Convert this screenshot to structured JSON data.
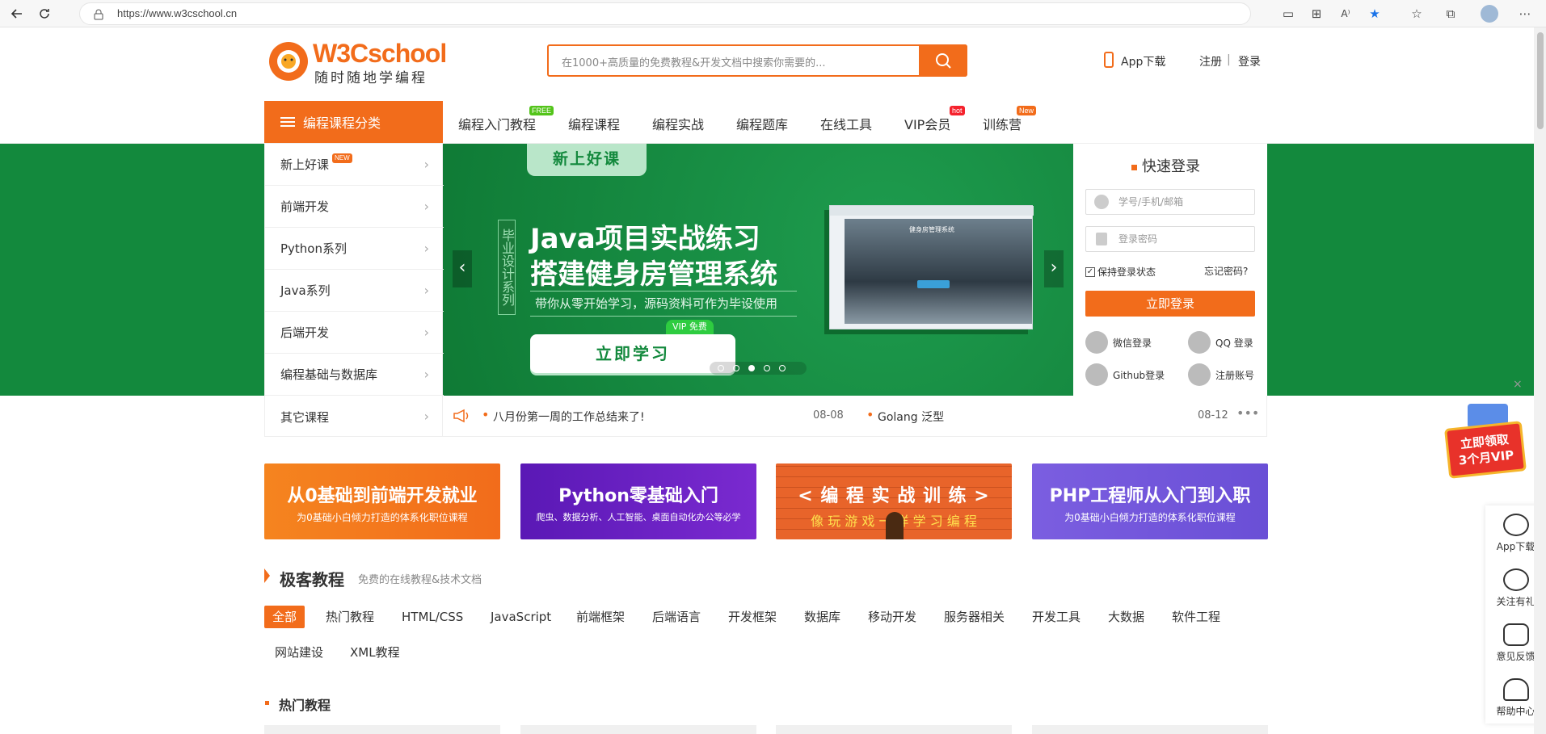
{
  "browser": {
    "url": "https://www.w3cschool.cn"
  },
  "logo": {
    "name": "W3Cschool",
    "tagline": "随时随地学编程"
  },
  "search": {
    "placeholder": "在1000+高质量的免费教程&开发文档中搜索你需要的..."
  },
  "header": {
    "app_download": "App下载",
    "register": "注册",
    "separator": "|",
    "login": "登录"
  },
  "nav": {
    "category_button": "编程课程分类",
    "items": [
      {
        "label": "编程入门教程",
        "badge": "FREE",
        "badge_color": "#53c41a"
      },
      {
        "label": "编程课程",
        "badge": "",
        "badge_color": ""
      },
      {
        "label": "编程实战",
        "badge": "",
        "badge_color": ""
      },
      {
        "label": "编程题库",
        "badge": "",
        "badge_color": ""
      },
      {
        "label": "在线工具",
        "badge": "",
        "badge_color": ""
      },
      {
        "label": "VIP会员",
        "badge": "hot",
        "badge_color": "#f5222d"
      },
      {
        "label": "训练营",
        "badge": "New",
        "badge_color": "#f26c1b"
      }
    ]
  },
  "sidebar": {
    "items": [
      {
        "label": "新上好课",
        "badge": "NEW"
      },
      {
        "label": "前端开发"
      },
      {
        "label": "Python系列"
      },
      {
        "label": "Java系列"
      },
      {
        "label": "后端开发"
      },
      {
        "label": "编程基础与数据库"
      },
      {
        "label": "其它课程"
      }
    ]
  },
  "banner": {
    "tag": "新上好课",
    "vertical_text": "毕业设计系列",
    "title_line1": "Java项目实战练习",
    "title_line2": "搭建健身房管理系统",
    "subtitle": "带你从零开始学习，源码资料可作为毕设使用",
    "vip_badge": "VIP 免费",
    "cta": "立即学习",
    "screen_title": "健身房管理系统",
    "dots": 5,
    "active_dot": 3
  },
  "login_panel": {
    "title": "快速登录",
    "username_placeholder": "学号/手机/邮箱",
    "password_placeholder": "登录密码",
    "remember": "保持登录状态",
    "forgot": "忘记密码?",
    "submit": "立即登录",
    "social": [
      {
        "label": "微信登录"
      },
      {
        "label": "QQ 登录"
      },
      {
        "label": "Github登录"
      },
      {
        "label": "注册账号"
      }
    ]
  },
  "notices": [
    {
      "text": "八月份第一周的工作总结来了!",
      "date": "08-08"
    },
    {
      "text": "Golang 泛型",
      "date": "08-12"
    }
  ],
  "promos": [
    {
      "title": "从0基础到前端开发就业",
      "subtitle": "为0基础小白倾力打造的体系化职位课程",
      "color": "#f26c1b"
    },
    {
      "title": "Python零基础入门",
      "subtitle": "爬虫、数据分析、人工智能、桌面自动化办公等必学",
      "color": "#6a1bc4"
    },
    {
      "title": "< 编 程 实 战 训 练 >",
      "subtitle": "像 玩 游 戏 一 样 学 习 编 程",
      "color": "#e8642a"
    },
    {
      "title": "PHP工程师从入门到入职",
      "subtitle": "为0基础小白倾力打造的体系化职位课程",
      "color": "#7b5ee0"
    }
  ],
  "section": {
    "title": "极客教程",
    "subtitle": "免费的在线教程&技术文档",
    "tags_row1": [
      "全部",
      "热门教程",
      "HTML/CSS",
      "JavaScript",
      "前端框架",
      "后端语言",
      "开发框架",
      "数据库",
      "移动开发",
      "服务器相关",
      "开发工具",
      "大数据",
      "软件工程"
    ],
    "tags_row2": [
      "网站建设",
      "XML教程"
    ],
    "hot_title": "热门教程"
  },
  "vip_float": {
    "line1": "立即领取",
    "line2": "3个月VIP"
  },
  "float_bar": {
    "items": [
      {
        "label": "App下载",
        "icon": "app-icon"
      },
      {
        "label": "关注有礼",
        "icon": "wechat-icon"
      },
      {
        "label": "意见反馈",
        "icon": "feedback-icon"
      },
      {
        "label": "帮助中心",
        "icon": "headset-icon"
      }
    ]
  },
  "colors": {
    "accent": "#f26c1b",
    "banner_green": "#13893d"
  }
}
